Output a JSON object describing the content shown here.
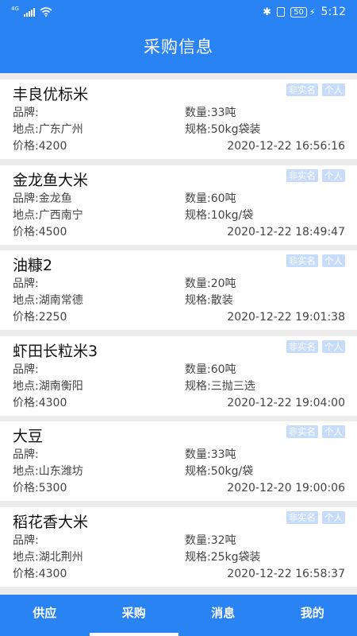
{
  "status_bar": {
    "network": "4G",
    "battery": "50",
    "time": "5:12"
  },
  "header": {
    "title": "采购信息"
  },
  "labels": {
    "brand": "品牌:",
    "quantity": "数量:",
    "location": "地点:",
    "spec": "规格:",
    "price": "价格:"
  },
  "items": [
    {
      "name": "丰良优标米",
      "tags": [
        "非实名",
        "个人"
      ],
      "brand": "",
      "quantity": "33吨",
      "location": "广东广州",
      "spec": "50kg袋装",
      "price": "4200",
      "date": "2020-12-22 16:56:16"
    },
    {
      "name": "金龙鱼大米",
      "tags": [
        "非实名",
        "个人"
      ],
      "brand": "金龙鱼",
      "quantity": "60吨",
      "location": "广西南宁",
      "spec": "10kg/袋",
      "price": "4500",
      "date": "2020-12-22 18:49:47"
    },
    {
      "name": "油糠2",
      "tags": [
        "非实名",
        "个人"
      ],
      "brand": "",
      "quantity": "20吨",
      "location": "湖南常德",
      "spec": "散装",
      "price": "2250",
      "date": "2020-12-22 19:01:38"
    },
    {
      "name": "虾田长粒米3",
      "tags": [
        "非实名",
        "个人"
      ],
      "brand": "",
      "quantity": "60吨",
      "location": "湖南衡阳",
      "spec": "三抛三选",
      "price": "4300",
      "date": "2020-12-22 19:04:00"
    },
    {
      "name": "大豆",
      "tags": [
        "非实名",
        "个人"
      ],
      "brand": "",
      "quantity": "33吨",
      "location": "山东潍坊",
      "spec": "50kg/袋",
      "price": "5300",
      "date": "2020-12-20 19:00:06"
    },
    {
      "name": "稻花香大米",
      "tags": [
        "非实名",
        "个人"
      ],
      "brand": "",
      "quantity": "32吨",
      "location": "湖北荆州",
      "spec": "25kg袋装",
      "price": "4300",
      "date": "2020-12-22 16:58:37"
    }
  ],
  "tabs": [
    {
      "label": "供应",
      "active": false
    },
    {
      "label": "采购",
      "active": true
    },
    {
      "label": "消息",
      "active": false
    },
    {
      "label": "我的",
      "active": false
    }
  ],
  "colors": {
    "primary": "#2a83f2",
    "tag_bg": "#c6dcfa",
    "background": "#ececec"
  }
}
